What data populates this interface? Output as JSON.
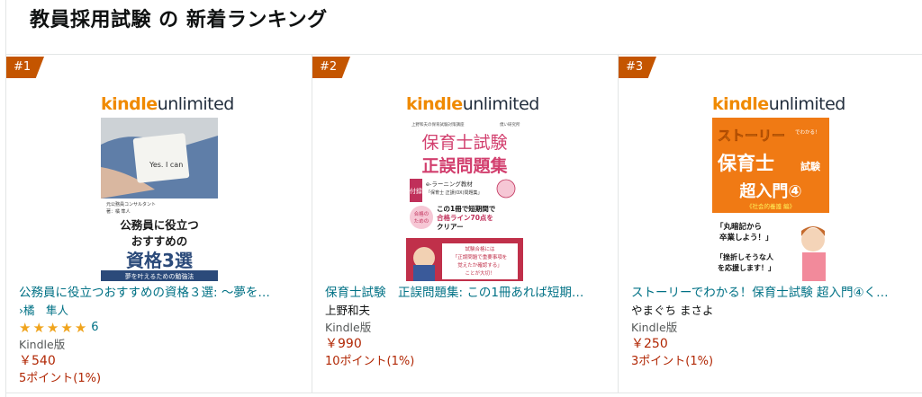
{
  "header": {
    "title": "教員採用試験 の 新着ランキング"
  },
  "kindle_logo": {
    "part1": "kindle",
    "part2": "unlimited"
  },
  "items": [
    {
      "rank": "#1",
      "title": "公務員に役立つおすすめの資格３選: ～夢を…",
      "author": "›橘　隼人",
      "rating_count": "6",
      "format": "Kindle版",
      "price": "￥540",
      "points": "5ポイント(1%)",
      "cover": {
        "author_lines": [
          "元公務員コンサルタント",
          "著：橘 隼人"
        ],
        "title_line1": "公務員に役立つ",
        "title_line2": "おすすめの",
        "title_big": "資格3選",
        "subtitle": "夢を叶えるための勉強法",
        "note_text": "Yes. I can"
      }
    },
    {
      "rank": "#2",
      "title": "保育士試験　正誤問題集: この1冊あれば短期…",
      "author": "上野和夫",
      "format": "Kindle版",
      "price": "￥990",
      "points": "10ポイント(1%)",
      "cover": {
        "top_small": "上野和夫の保育試験対策講座",
        "publisher": "僕い研究所",
        "title1": "保育士試験",
        "title2": "正誤問題集",
        "appendix": "付録",
        "elearn1": "e-ラーニング教材",
        "elearn2": "「保育士 正誤(OX)問題集」",
        "circle1": "合格の",
        "circle2": "ための",
        "line1": "この1冊で短期間で",
        "line2": "合格ライン70点を",
        "line3": "クリアー",
        "bottom1": "試験合格には",
        "bottom2": "「正誤問題で重要事項を",
        "bottom3": "覚えたか確認する」",
        "bottom4": "ことが大切！"
      }
    },
    {
      "rank": "#3",
      "title": "ストーリーでわかる！保育士試験 超入門④く…",
      "author": "やまぐち まさよ",
      "format": "Kindle版",
      "price": "￥250",
      "points": "3ポイント(1%)",
      "cover": {
        "story": "ストーリー",
        "deWakaru": "でわかる！",
        "hoikushi": "保育士",
        "shiken": "試験",
        "chonyumon": "超入門④",
        "sub": "《社会的養護 編》",
        "bubble1a": "「丸暗記から",
        "bubble1b": "卒業しよう！」",
        "bubble2a": "「挫折しそうな人",
        "bubble2b": "を応援します！」"
      }
    }
  ],
  "colors": {
    "link": "#007185",
    "price": "#b12704",
    "rank_badge": "#c45500",
    "star": "#f0a41d"
  }
}
